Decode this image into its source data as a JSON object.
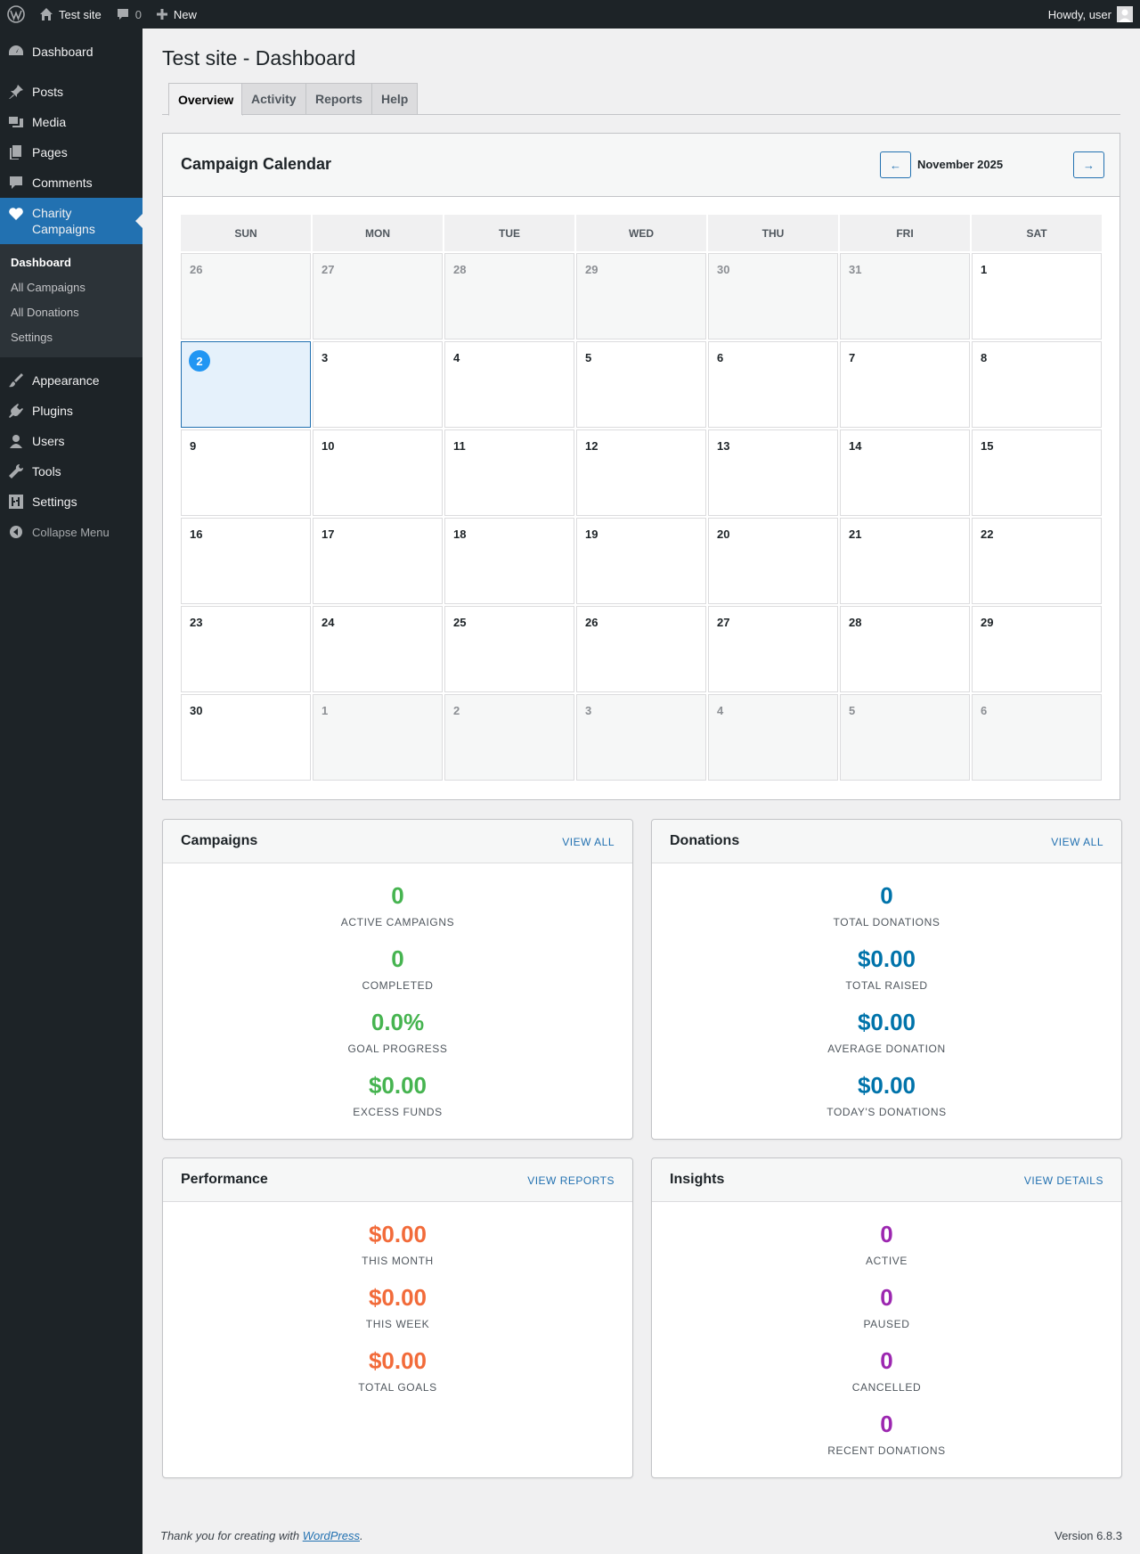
{
  "adminbar": {
    "site_name": "Test site",
    "comments_count": "0",
    "new_label": "New",
    "howdy": "Howdy, user"
  },
  "sidebar": {
    "items": [
      {
        "label": "Dashboard",
        "icon": "dashboard-icon"
      },
      {
        "label": "Posts",
        "icon": "pin-icon"
      },
      {
        "label": "Media",
        "icon": "media-icon"
      },
      {
        "label": "Pages",
        "icon": "pages-icon"
      },
      {
        "label": "Comments",
        "icon": "comment-icon"
      },
      {
        "label": "Charity Campaigns",
        "icon": "heart-icon"
      },
      {
        "label": "Appearance",
        "icon": "brush-icon"
      },
      {
        "label": "Plugins",
        "icon": "plug-icon"
      },
      {
        "label": "Users",
        "icon": "user-icon"
      },
      {
        "label": "Tools",
        "icon": "wrench-icon"
      },
      {
        "label": "Settings",
        "icon": "settings-icon"
      }
    ],
    "submenu": [
      "Dashboard",
      "All Campaigns",
      "All Donations",
      "Settings"
    ],
    "collapse_label": "Collapse Menu"
  },
  "page": {
    "title": "Test site - Dashboard",
    "tabs": [
      "Overview",
      "Activity",
      "Reports",
      "Help"
    ]
  },
  "calendar": {
    "title": "Campaign Calendar",
    "month": "November 2025",
    "prev_label": "←",
    "next_label": "→",
    "days_of_week": [
      "SUN",
      "MON",
      "TUE",
      "WED",
      "THU",
      "FRI",
      "SAT"
    ],
    "weeks": [
      [
        "26",
        "27",
        "28",
        "29",
        "30",
        "31",
        "1"
      ],
      [
        "2",
        "3",
        "4",
        "5",
        "6",
        "7",
        "8"
      ],
      [
        "9",
        "10",
        "11",
        "12",
        "13",
        "14",
        "15"
      ],
      [
        "16",
        "17",
        "18",
        "19",
        "20",
        "21",
        "22"
      ],
      [
        "23",
        "24",
        "25",
        "26",
        "27",
        "28",
        "29"
      ],
      [
        "30",
        "1",
        "2",
        "3",
        "4",
        "5",
        "6"
      ]
    ],
    "today": "2"
  },
  "campaigns": {
    "title": "Campaigns",
    "link": "VIEW ALL",
    "metrics": [
      {
        "value": "0",
        "label": "ACTIVE CAMPAIGNS"
      },
      {
        "value": "0",
        "label": "COMPLETED"
      },
      {
        "value": "0.0%",
        "label": "GOAL PROGRESS"
      },
      {
        "value": "$0.00",
        "label": "EXCESS FUNDS"
      }
    ]
  },
  "donations": {
    "title": "Donations",
    "link": "VIEW ALL",
    "metrics": [
      {
        "value": "0",
        "label": "TOTAL DONATIONS"
      },
      {
        "value": "$0.00",
        "label": "TOTAL RAISED"
      },
      {
        "value": "$0.00",
        "label": "AVERAGE DONATION"
      },
      {
        "value": "$0.00",
        "label": "TODAY'S DONATIONS"
      }
    ]
  },
  "performance": {
    "title": "Performance",
    "link": "VIEW REPORTS",
    "metrics": [
      {
        "value": "$0.00",
        "label": "THIS MONTH"
      },
      {
        "value": "$0.00",
        "label": "THIS WEEK"
      },
      {
        "value": "$0.00",
        "label": "TOTAL GOALS"
      }
    ]
  },
  "insights": {
    "title": "Insights",
    "link": "VIEW DETAILS",
    "metrics": [
      {
        "value": "0",
        "label": "ACTIVE"
      },
      {
        "value": "0",
        "label": "PAUSED"
      },
      {
        "value": "0",
        "label": "CANCELLED"
      },
      {
        "value": "0",
        "label": "RECENT DONATIONS"
      }
    ]
  },
  "footer": {
    "thanks_prefix": "Thank you for creating with ",
    "link_text": "WordPress",
    "thanks_suffix": ".",
    "version": "Version 6.8.3"
  },
  "colors": {
    "accent": "#2271b1",
    "campaigns": "#46b450",
    "donations": "#0073aa",
    "performance": "#f26b3a",
    "insights": "#9c27b0"
  }
}
